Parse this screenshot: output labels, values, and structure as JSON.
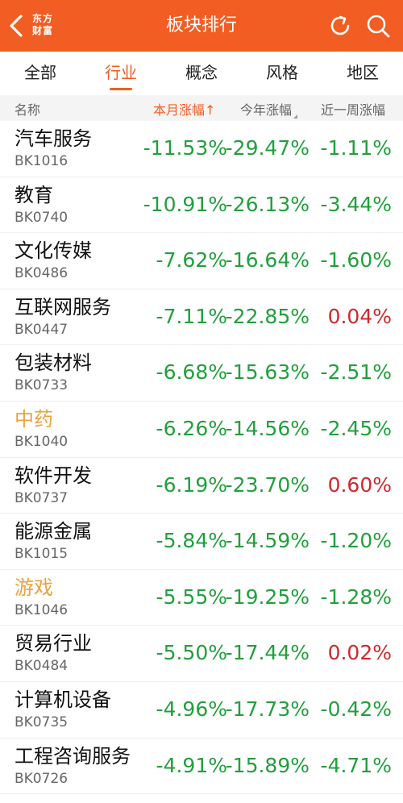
{
  "header": {
    "title": "板块排行",
    "logo_line1": "东方",
    "logo_line2": "财富"
  },
  "tabs": [
    {
      "label": "全部",
      "active": false
    },
    {
      "label": "行业",
      "active": true
    },
    {
      "label": "概念",
      "active": false
    },
    {
      "label": "风格",
      "active": false
    },
    {
      "label": "地区",
      "active": false
    }
  ],
  "columns": {
    "name": "名称",
    "month": "本月涨幅",
    "month_arrow": "↑",
    "year": "今年涨幅",
    "week": "近一周涨幅"
  },
  "colors": {
    "brand": "#f15d22",
    "down": "#20a03c",
    "up": "#d0282f",
    "highlight_name": "#e8a33d"
  },
  "rows": [
    {
      "name": "汽车服务",
      "code": "BK1016",
      "month": "-11.53%",
      "year": "-29.47%",
      "week": "-1.11%",
      "week_up": false,
      "highlight": false
    },
    {
      "name": "教育",
      "code": "BK0740",
      "month": "-10.91%",
      "year": "-26.13%",
      "week": "-3.44%",
      "week_up": false,
      "highlight": false
    },
    {
      "name": "文化传媒",
      "code": "BK0486",
      "month": "-7.62%",
      "year": "-16.64%",
      "week": "-1.60%",
      "week_up": false,
      "highlight": false
    },
    {
      "name": "互联网服务",
      "code": "BK0447",
      "month": "-7.11%",
      "year": "-22.85%",
      "week": "0.04%",
      "week_up": true,
      "highlight": false
    },
    {
      "name": "包装材料",
      "code": "BK0733",
      "month": "-6.68%",
      "year": "-15.63%",
      "week": "-2.51%",
      "week_up": false,
      "highlight": false
    },
    {
      "name": "中药",
      "code": "BK1040",
      "month": "-6.26%",
      "year": "-14.56%",
      "week": "-2.45%",
      "week_up": false,
      "highlight": true
    },
    {
      "name": "软件开发",
      "code": "BK0737",
      "month": "-6.19%",
      "year": "-23.70%",
      "week": "0.60%",
      "week_up": true,
      "highlight": false
    },
    {
      "name": "能源金属",
      "code": "BK1015",
      "month": "-5.84%",
      "year": "-14.59%",
      "week": "-1.20%",
      "week_up": false,
      "highlight": false
    },
    {
      "name": "游戏",
      "code": "BK1046",
      "month": "-5.55%",
      "year": "-19.25%",
      "week": "-1.28%",
      "week_up": false,
      "highlight": true
    },
    {
      "name": "贸易行业",
      "code": "BK0484",
      "month": "-5.50%",
      "year": "-17.44%",
      "week": "0.02%",
      "week_up": true,
      "highlight": false
    },
    {
      "name": "计算机设备",
      "code": "BK0735",
      "month": "-4.96%",
      "year": "-17.73%",
      "week": "-0.42%",
      "week_up": false,
      "highlight": false
    },
    {
      "name": "工程咨询服务",
      "code": "BK0726",
      "month": "-4.91%",
      "year": "-15.89%",
      "week": "-4.71%",
      "week_up": false,
      "highlight": false
    }
  ]
}
